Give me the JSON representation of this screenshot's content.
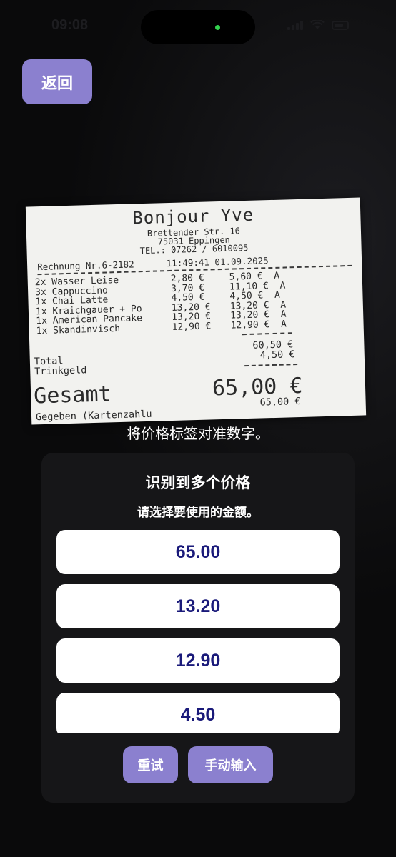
{
  "status_bar": {
    "time": "09:08"
  },
  "back_label": "返回",
  "receipt": {
    "shop_name": "Bonjour Yve",
    "street": "Brettender Str. 16",
    "city": "75031 Eppingen",
    "phone": "TEL.: 07262 / 6010095",
    "invoice_line": "Rechnung Nr.6-2182      11:49:41 01.09.2025",
    "items": [
      {
        "name": "2x Wasser Leise",
        "unit": "2,80 €",
        "total": "5,60 €  A"
      },
      {
        "name": "3x Cappuccino",
        "unit": "3,70 €",
        "total": "11,10 €  A"
      },
      {
        "name": "1x Chai Latte",
        "unit": "4,50 €",
        "total": "4,50 €  A"
      },
      {
        "name": "1x Kraichgauer + Po",
        "unit": "13,20 €",
        "total": "13,20 €  A"
      },
      {
        "name": "1x American Pancake",
        "unit": "13,20 €",
        "total": "13,20 €  A"
      },
      {
        "name": "1x Skandinvisch",
        "unit": "12,90 €",
        "total": "12,90 €  A"
      }
    ],
    "total_label": "Total",
    "total_value": "60,50 €",
    "tip_label": "Trinkgeld",
    "tip_value": "4,50 €",
    "gesamt_label": "Gesamt",
    "gesamt_value": "65,00 €",
    "footer_left": "Gegeben (Kartenzahlu",
    "footer_right": "65,00 €"
  },
  "instruction": "将价格标签对准数字。",
  "panel": {
    "title": "识别到多个价格",
    "subtitle": "请选择要使用的金额。",
    "prices": [
      "65.00",
      "13.20",
      "12.90",
      "4.50"
    ],
    "retry_label": "重试",
    "manual_label": "手动输入"
  },
  "colors": {
    "accent": "#8b80cf",
    "price_text": "#1a1a7a",
    "panel_bg": "#161618"
  }
}
